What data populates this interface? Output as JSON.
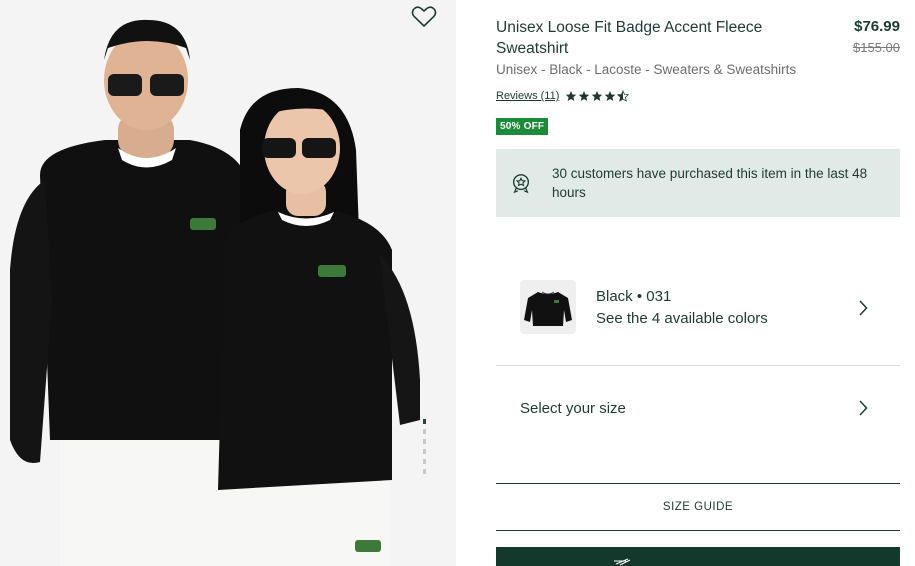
{
  "product": {
    "title": "Unisex Loose Fit Badge Accent Fleece Sweatshirt",
    "price_current": "$76.99",
    "price_original": "$155.00",
    "breadcrumb": "Unisex - Black - Lacoste - Sweaters & Sweatshirts",
    "reviews_label": "Reviews (11)",
    "rating": 4.5,
    "discount_badge": "50% OFF"
  },
  "notice": {
    "text": "30 customers have purchased this item in the last 48 hours",
    "icon": "award-badge-icon"
  },
  "color": {
    "name": "Black • 031",
    "more_colors": "See the 4 available colors"
  },
  "size": {
    "label": "Select your size"
  },
  "size_guide": {
    "label": "SIZE GUIDE"
  },
  "gallery": {
    "image_count": 6,
    "active_index": 0
  },
  "colors": {
    "brand_dark": "#13392d",
    "badge_green": "#1b8a3a",
    "notice_bg": "#e2eae7"
  }
}
